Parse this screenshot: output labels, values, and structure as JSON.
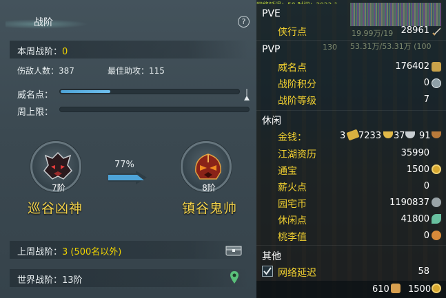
{
  "left": {
    "title": "战阶",
    "help_symbol": "?",
    "this_week_label": "本周战阶：",
    "this_week_value": "0",
    "defeated": "伤敌人数：387",
    "best_assist": "最佳助攻：115",
    "fame_label": "威名点：",
    "fame_progress": 0.28,
    "week_cap_label": "周上限：",
    "week_cap_progress": 0.0,
    "current_rank": {
      "tier": "7阶",
      "name": "巡谷凶神"
    },
    "next_rank": {
      "tier": "8阶",
      "name": "镇谷鬼帅"
    },
    "progress_pct": "77%",
    "last_week_label": "上周战阶：",
    "last_week_value": "3 (500名以外)",
    "world_label": "世界战阶：13阶"
  },
  "right": {
    "top_strip": "网络延迟：58 时间：2023-1",
    "pve_header": "PVE",
    "pvp_header": "PVP",
    "leisure_header": "休闲",
    "other_header": "其他",
    "ghost_1": "19.99万/19",
    "ghost_2": "130",
    "ghost_3": "53.31万/53.31万 (100",
    "rows": {
      "xiahang": {
        "label": "侠行点",
        "value": "28961"
      },
      "weiming": {
        "label": "威名点",
        "value": "176402"
      },
      "zhanjie_jifen": {
        "label": "战阶积分",
        "value": "0"
      },
      "zhanjie_dengji": {
        "label": "战阶等级",
        "value": "7"
      },
      "jinqian": {
        "label": "金钱：",
        "v1": "3",
        "v2": "7233",
        "v3": "37",
        "v4": "91"
      },
      "jianghu": {
        "label": "江湖资历",
        "value": "35990"
      },
      "tongbao": {
        "label": "通宝",
        "value": "1500"
      },
      "xinhuo": {
        "label": "薪火点",
        "value": "0"
      },
      "yuanzhai": {
        "label": "园宅币",
        "value": "1190837"
      },
      "xiuxian": {
        "label": "休闲点",
        "value": "41800"
      },
      "taoli": {
        "label": "桃李值",
        "value": "0"
      },
      "latency": {
        "label": "网络延迟",
        "value": "58"
      }
    },
    "bottom_left": "610",
    "bottom_right": "1500"
  },
  "colors": {
    "accent_yellow": "#f1d400",
    "label_gold": "#f0cf30",
    "bar_blue": "#5fb4e6"
  }
}
